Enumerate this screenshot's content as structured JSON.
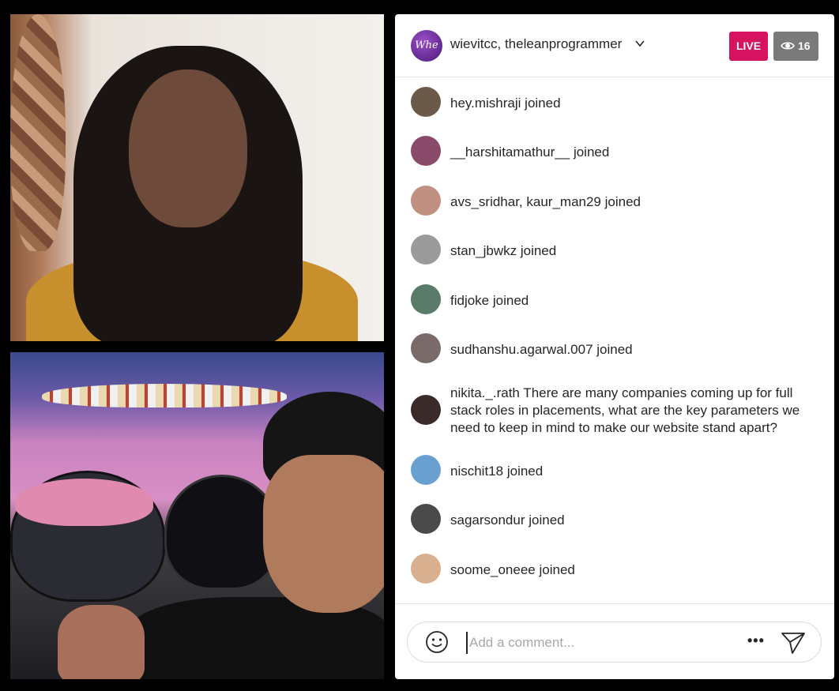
{
  "header": {
    "title": "wievitcc, theleanprogrammer",
    "avatar_text": "Whe",
    "live_label": "LIVE",
    "viewer_count": "16"
  },
  "feed": [
    {
      "user": "hey.mishraji",
      "text": " joined",
      "avatar": "#6b5a4a"
    },
    {
      "user": "__harshitamathur__",
      "text": " joined",
      "avatar": "#8a4a6a"
    },
    {
      "user": "avs_sridhar, kaur_man29",
      "text": " joined",
      "avatar": "#c09080"
    },
    {
      "user": "stan_jbwkz",
      "text": " joined",
      "avatar": "#9a9a9a"
    },
    {
      "user": "fidjoke",
      "text": " joined",
      "avatar": "#5a7a6a"
    },
    {
      "user": "sudhanshu.agarwal.007",
      "text": " joined",
      "avatar": "#7a6a6a"
    },
    {
      "user": "nikita._.rath",
      "text": " There are many companies coming up for full stack roles in placements, what are the key parameters we need to keep in mind to make our website stand apart?",
      "avatar": "#3a2a2a"
    },
    {
      "user": "nischit18",
      "text": " joined",
      "avatar": "#6aa0d0"
    },
    {
      "user": "sagarsondur",
      "text": " joined",
      "avatar": "#4a4a4a"
    },
    {
      "user": "soome_oneee",
      "text": " joined",
      "avatar": "#d8b090"
    }
  ],
  "footer": {
    "comment_placeholder": "Add a comment...",
    "more_label": "•••"
  },
  "colors": {
    "live": "#d6135e",
    "viewers_bg": "#7a7a7a",
    "text": "#262626"
  },
  "icons": [
    "eye-icon",
    "chevron-down-icon",
    "emoji-icon",
    "more-icon",
    "send-icon"
  ]
}
